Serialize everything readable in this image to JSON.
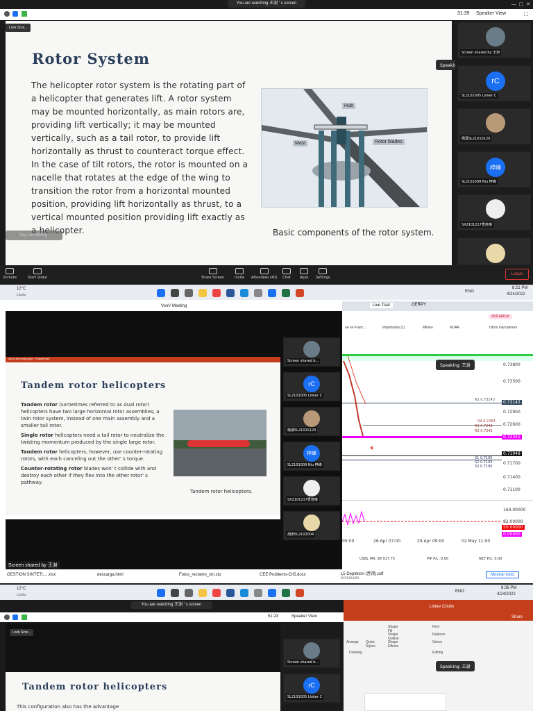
{
  "s1": {
    "banner": "You are watching 王澍 ' s screen",
    "time": "31:39",
    "speaker_view": "Speaker View",
    "lock_screen": "Lock Scre...",
    "slide": {
      "title": "Rotor System",
      "body": "The helicopter rotor system is the rotating part of a helicopter that generates lift. A rotor system may be mounted horizontally, as main rotors are, providing lift vertically; it may be mounted vertically, such as a tail rotor, to provide lift horizontally as thrust to counteract torque effect. In the case of tilt rotors, the rotor is mounted on a nacelle that rotates at the edge of the wing to transition the rotor from a horizontal mounted position, providing lift horizontally as thrust, to a vertical mounted position providing lift exactly as a helicopter.",
      "caption": "Basic components of the rotor system.",
      "labels": {
        "hub": "Hub",
        "mast": "Mast",
        "blades": "Rotor blades"
      }
    },
    "say_something": "Say something",
    "speaking": "Speaking: 王澍",
    "participants": [
      {
        "name": "Screen shared by 王澍",
        "avatar": ""
      },
      {
        "name": "SL2101005 Linker C",
        "avatar": "rC"
      },
      {
        "name": "杨潇SL2101S120",
        "avatar": ""
      },
      {
        "name": "SL2101009 Niu 梓峰",
        "avatar": "梓峰"
      },
      {
        "name": "SX2101217雪佳琳",
        "avatar": ""
      }
    ],
    "controls": [
      "Unmute",
      "Start Video",
      "Share Screen",
      "Invite",
      "Attendees (40)",
      "Chat",
      "Apps",
      "Settings"
    ],
    "leave": "Leave"
  },
  "tb1": {
    "temp": "12°C",
    "weather": "Lluvia",
    "lang": "ENG",
    "time": "8:21 PM",
    "date": "4/24/2022"
  },
  "s2": {
    "app_title": "VooV Meeting",
    "ppt_title": "Art of the Helicopter - PowerPoint",
    "slide": {
      "title": "Tandem rotor helicopters",
      "p1_bold": "Tandem rotor",
      "p1": " (sometimes referred to as dual rotor) helicopters have two large horizontal rotor assemblies; a twin rotor system, instead of one main assembly and a smaller tail rotor.",
      "p2_bold": "Single rotor",
      "p2": " helicopters need a tail rotor to neutralize the twisting momentum produced by the single large rotor.",
      "p3_bold": "Tandem rotor",
      "p3": " helicopters, however, use counter-rotating rotors, with each canceling out the other' s torque.",
      "p4_bold": "Counter-rotating rotor",
      "p4": " blades won' t collide with and destroy each other if they flex into the other rotor' s pathway.",
      "caption": "Tandem rotor helicopters."
    },
    "participants": [
      {
        "name": "Screen shared b...",
        "avatar": ""
      },
      {
        "name": "SL2101005 Linker C",
        "avatar": "rC"
      },
      {
        "name": "杨潇SL2101S120",
        "avatar": ""
      },
      {
        "name": "SL2101009 Niu 梓峰",
        "avatar": "梓峰"
      },
      {
        "name": "SX2101217雪佳琳",
        "avatar": ""
      },
      {
        "name": "胡澍SL2102004",
        "avatar": ""
      }
    ],
    "shared_by": "Screen shared by 王澍",
    "speaking": "Speaking: 王澍",
    "browser": {
      "tabs": [
        "Live Trad",
        "GERPY"
      ],
      "actualizar": "Actualizar",
      "bookmarks": [
        "ue en Franc...",
        "Importados (1)",
        "Milano",
        "NUAA",
        "Otros marcadores"
      ],
      "prices": [
        "0.73800",
        "0.73500",
        "0.73143",
        "0.72900",
        "0.72600",
        "0.72341",
        "0.71948",
        "0.71700",
        "0.71400",
        "0.71100"
      ],
      "lines": [
        "R1 0.73143",
        "R4 0.7263",
        "R3 0.7249",
        "R2 0.7242",
        "S1 0.7195",
        "S2 0.7193",
        "S3 0.7190"
      ],
      "osc": [
        "164.00000",
        "82.00000",
        "50.00000",
        "0.00000"
      ],
      "dates": [
        "05:00",
        "26 Apr 07:00",
        "29 Apr 09:00",
        "02 May 11:00"
      ],
      "footer": {
        "usbl": "USBL MR:",
        "usbl_v": "99 917.75",
        "pip": "PIP P/L:",
        "pip_v": "0.00",
        "net": "NET P/L:",
        "net_v": "0.00"
      }
    }
  },
  "downloads": {
    "items": [
      "GESTION SINTETI.....xlsx",
      "descarga.html",
      "Fotos_reclamo_xm.zip",
      "CEE Problems-Ch5.docx",
      "L5 Depletion (音视).pdf"
    ],
    "sub": "Eliminado",
    "show_all": "Mostrar todo"
  },
  "tb2": {
    "temp": "12°C",
    "weather": "Lluvia",
    "lang": "ENG",
    "time": "8:36 PM",
    "date": "4/24/2022"
  },
  "s3": {
    "banner": "You are watching 王澍 ' s screen",
    "time": "51:23",
    "speaker_view": "Speaker View",
    "lock_screen": "Lock Scre...",
    "slide_title": "Tandem rotor helicopters",
    "slide_text": "This configuration also has the advantage",
    "participants": [
      {
        "name": "Screen shared b...",
        "avatar": ""
      },
      {
        "name": "SL2101005 Linker C",
        "avatar": "rC"
      }
    ],
    "ribbon": {
      "user": "Linker Criollo",
      "share": "Share",
      "shape_fill": "Shape Fill",
      "shape_outline": "Shape Outline",
      "shape_effects": "Shape Effects",
      "arrange": "Arrange",
      "quick_styles": "Quick Styles",
      "drawing": "Drawing",
      "find": "Find",
      "replace": "Replace",
      "select": "Select",
      "editing": "Editing"
    },
    "speaking": "Speaking: 王澍"
  }
}
